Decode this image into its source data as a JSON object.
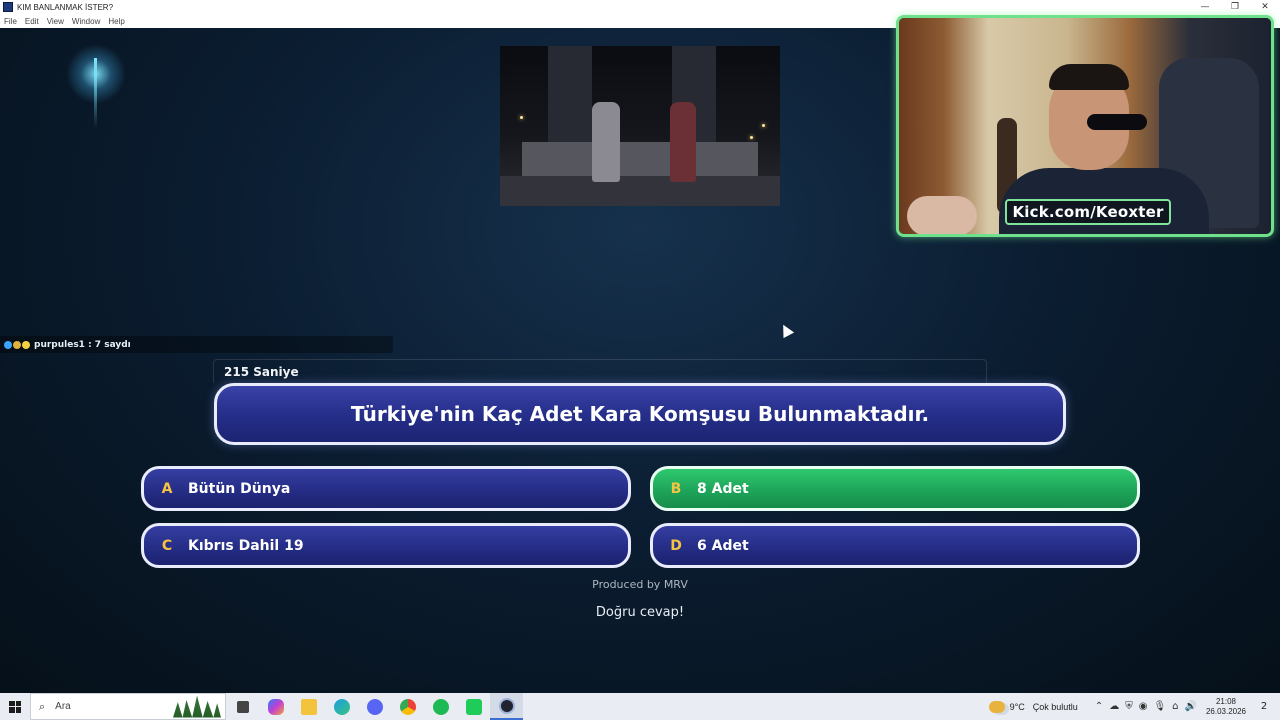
{
  "window": {
    "title": "KIM BANLANMAK İSTER?",
    "controls": {
      "minimize": "—",
      "restore": "❐",
      "close": "✕"
    }
  },
  "menu": [
    "File",
    "Edit",
    "View",
    "Window",
    "Help"
  ],
  "webcam": {
    "overlay_text": "Kick.com/Keoxter"
  },
  "chat": {
    "message": "purpules1 : 7 saydı"
  },
  "quiz": {
    "timer": "215 Saniye",
    "question": "Türkiye'nin Kaç Adet Kara Komşusu Bulunmaktadır.",
    "answers": [
      {
        "letter": "A",
        "text": "Bütün Dünya",
        "correct": false
      },
      {
        "letter": "B",
        "text": "8 Adet",
        "correct": true
      },
      {
        "letter": "C",
        "text": "Kıbrıs Dahil 19",
        "correct": false
      },
      {
        "letter": "D",
        "text": "6 Adet",
        "correct": false
      }
    ],
    "produced_by": "Produced by MRV",
    "result_message": "Doğru cevap!"
  },
  "colors": {
    "answer_default": "#262f8a",
    "answer_correct": "#1ea55a",
    "letter": "#f5c542",
    "webcam_border": "#6fe08c"
  },
  "taskbar": {
    "search_placeholder": "Ara",
    "apps": [
      "task-view-icon",
      "copilot-icon",
      "file-explorer-icon",
      "edge-icon",
      "discord-icon",
      "chrome-icon",
      "spotify-icon",
      "kick-icon",
      "obs-icon"
    ],
    "weather": {
      "temp": "9°C",
      "desc": "Çok bulutlu"
    },
    "time": "21:08",
    "date": "26.03.2026",
    "notification_count": "2"
  }
}
